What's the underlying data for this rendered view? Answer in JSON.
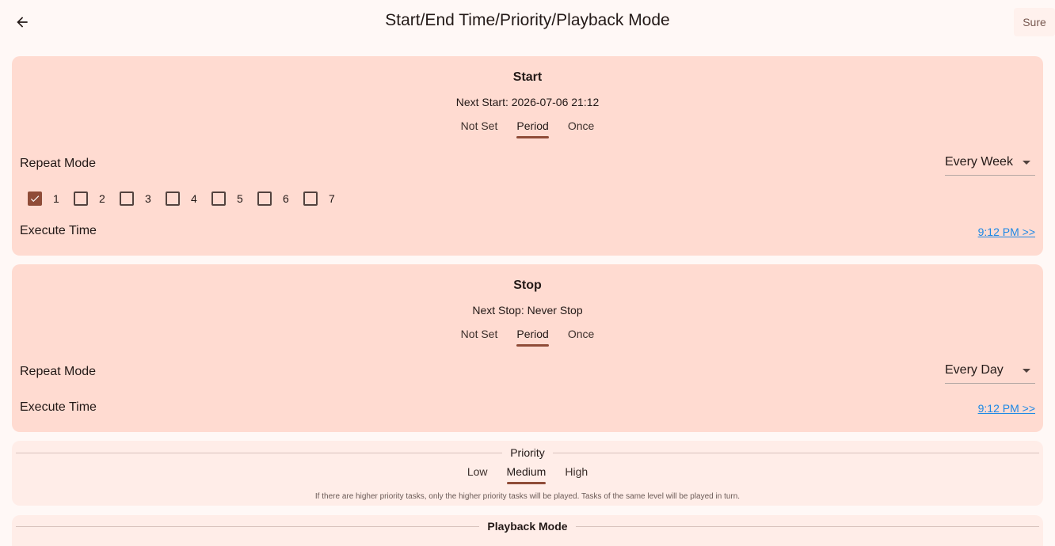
{
  "header": {
    "title": "Start/End Time/Priority/Playback Mode",
    "confirm_label": "Sure"
  },
  "start": {
    "title": "Start",
    "next_line": "Next Start: 2026-07-06 21:12",
    "segments": [
      "Not Set",
      "Period",
      "Once"
    ],
    "selected_segment": "Period",
    "repeat_mode_label": "Repeat Mode",
    "repeat_mode_value": "Every Week",
    "weekdays": [
      {
        "label": "1",
        "checked": true
      },
      {
        "label": "2",
        "checked": false
      },
      {
        "label": "3",
        "checked": false
      },
      {
        "label": "4",
        "checked": false
      },
      {
        "label": "5",
        "checked": false
      },
      {
        "label": "6",
        "checked": false
      },
      {
        "label": "7",
        "checked": false
      }
    ],
    "execute_time_label": "Execute Time",
    "execute_time_value": "9:12 PM >>"
  },
  "stop": {
    "title": "Stop",
    "next_line": "Next Stop: Never Stop",
    "segments": [
      "Not Set",
      "Period",
      "Once"
    ],
    "selected_segment": "Period",
    "repeat_mode_label": "Repeat Mode",
    "repeat_mode_value": "Every Day",
    "execute_time_label": "Execute Time",
    "execute_time_value": "9:12 PM >>"
  },
  "priority": {
    "title": "Priority",
    "segments": [
      "Low",
      "Medium",
      "High"
    ],
    "selected_segment": "Medium",
    "note": "If there are higher priority tasks, only the higher priority tasks will be played. Tasks of the same level will be played in turn."
  },
  "playback": {
    "title": "Playback Mode"
  },
  "colors": {
    "background": "#fff8f6",
    "card": "#ffdbd1",
    "card_light": "#ffede8",
    "accent": "#8f4c38",
    "link": "#1e88e5"
  }
}
